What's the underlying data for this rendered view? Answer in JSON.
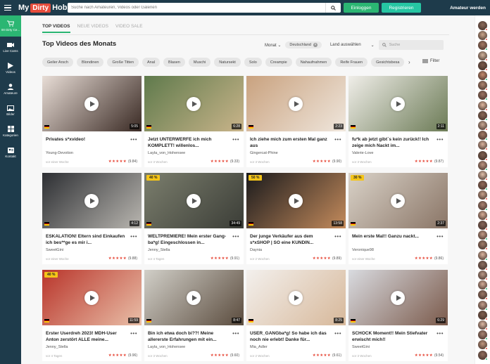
{
  "header": {
    "logo_my": "My",
    "logo_dirty": "Dirty",
    "logo_hobby": "Hobby",
    "search_placeholder": "Suche nach Amateuren, Videos oder Galerien",
    "login_label": "Einloggen",
    "register_label": "Registrieren",
    "become_amateur": "Amateur werden"
  },
  "sidebar": {
    "items": [
      {
        "label": "00 Dirty Ce...",
        "icon": "cart-icon",
        "active": true
      },
      {
        "label": "Live Cams",
        "icon": "camera-icon",
        "active": false
      },
      {
        "label": "Videos",
        "icon": "play-icon",
        "active": false
      },
      {
        "label": "Amateure",
        "icon": "user-icon",
        "active": false
      },
      {
        "label": "Bilder",
        "icon": "images-icon",
        "active": false
      },
      {
        "label": "Kategorien",
        "icon": "grid-icon",
        "active": false
      },
      {
        "label": "Kontakt",
        "icon": "contact-icon",
        "active": false
      }
    ]
  },
  "tabs": [
    {
      "label": "TOP VIDEOS",
      "active": true
    },
    {
      "label": "NEUE VIDEOS",
      "active": false
    },
    {
      "label": "VIDEO SALE",
      "active": false
    }
  ],
  "section_title": "Top Videos des Monats",
  "filters": {
    "period": "Monat",
    "country_chip": "Deutschland",
    "country_select": "Land auswählen",
    "search_placeholder": "Suche",
    "filter_label": "Filter"
  },
  "tags": [
    "Geiler Arsch",
    "Blondinen",
    "Große Titten",
    "Anal",
    "Blasen",
    "Muschi",
    "Natursekt",
    "Solo",
    "Creampie",
    "Nahaufnahmen",
    "Reife Frauen",
    "Gesichtsbesa"
  ],
  "videos": [
    {
      "title": "Privates s*xvideo!",
      "user": "Young-Devotion",
      "date": "vor einer Woche",
      "rating": "(9.84)",
      "duration": "5:05",
      "badge": "",
      "thumb_colors": [
        "#e8ddd6",
        "#3a2a24"
      ]
    },
    {
      "title": "Jetzt UNTERWERFE ich mich KOMPLETT! willenlos...",
      "user": "Layla_von_Hohensee",
      "date": "vor 3 Wochen",
      "rating": "(9.33)",
      "duration": "6:28",
      "badge": "",
      "thumb_colors": [
        "#5f7a4c",
        "#c9b48a"
      ]
    },
    {
      "title": "Ich ziehe mich zum ersten Mal ganz aus",
      "user": "Gingercat-Phine",
      "date": "vor 3 Wochen",
      "rating": "(9.90)",
      "duration": "2:23",
      "badge": "",
      "thumb_colors": [
        "#c9a27f",
        "#efe6dc"
      ]
    },
    {
      "title": "fu*k ab jetzt gibt´s kein zurück!! Ich zeige mich Nackt im...",
      "user": "Valerie-Love",
      "date": "vor 3 Wochen",
      "rating": "(9.87)",
      "duration": "2:11",
      "badge": "",
      "thumb_colors": [
        "#f0eee9",
        "#6c7b56"
      ]
    },
    {
      "title": "ESKALATION! Eltern sind Einkaufen ich bes**ge es mir i...",
      "user": "SweetGini",
      "date": "vor einer Woche",
      "rating": "(9.88)",
      "duration": "4:12",
      "badge": "",
      "thumb_colors": [
        "#2d2f33",
        "#b9b6b0"
      ]
    },
    {
      "title": "WELTPREMIERE! Mein erster Gang-ba*g! Eingeschlossen in...",
      "user": "Jenny_Stella",
      "date": "vor 4 Tagen",
      "rating": "(9.91)",
      "duration": "34:49",
      "badge": "40 %",
      "thumb_colors": [
        "#7b7e6d",
        "#3b3d37"
      ]
    },
    {
      "title": "Der junge Verkäufer aus dem s*xSHOP | SO eine KUNDIN...",
      "user": "Daynia",
      "date": "vor 2 Wochen",
      "rating": "(9.89)",
      "duration": "13:58",
      "badge": "50 %",
      "thumb_colors": [
        "#1a1a1c",
        "#c48b5c"
      ]
    },
    {
      "title": "Mein erste Mal!! Ganzu nackt...",
      "user": "Veronique98",
      "date": "vor einer Woche",
      "rating": "(9.86)",
      "duration": "2:37",
      "badge": "30 %",
      "thumb_colors": [
        "#d9d2c8",
        "#8a7566"
      ]
    },
    {
      "title": "Erster Userdreh 2023! MDH-User Anton zerstört ALLE meine...",
      "user": "Jenny_Stella",
      "date": "vor 4 Tagen",
      "rating": "(9.96)",
      "duration": "11:59",
      "badge": "40 %",
      "thumb_colors": [
        "#b9352b",
        "#e9bfa8"
      ]
    },
    {
      "title": "Bin ich etwa doch bi??! Meine allererste Erfahrungen mit ein...",
      "user": "Layla_von_Hohensee",
      "date": "vor 3 Wochen",
      "rating": "(9.60)",
      "duration": "8:47",
      "badge": "",
      "thumb_colors": [
        "#d1cfc8",
        "#5b4c3e"
      ]
    },
    {
      "title": "USER_GANGba*g! So habe ich das noch nie erlebt! Danke für...",
      "user": "Mia_Adler",
      "date": "vor 2 Wochen",
      "rating": "(9.61)",
      "duration": "8:25",
      "badge": "",
      "thumb_colors": [
        "#f3f0ed",
        "#d7b89a"
      ]
    },
    {
      "title": "SCHOCK Moment!! Mein Stiefvater erwischt mich!!",
      "user": "SweetGini",
      "date": "vor 3 Wochen",
      "rating": "(9.54)",
      "duration": "6:29",
      "badge": "",
      "thumb_colors": [
        "#d9dbe0",
        "#7b5a4b"
      ]
    }
  ],
  "right_avatars": [
    {
      "color": "#8b6b5b",
      "status": "#e74c3c"
    },
    {
      "color": "#c9a58a",
      "status": "#e74c3c"
    },
    {
      "color": "#a47a64",
      "status": "#2bb673"
    },
    {
      "color": "#d1b39c",
      "status": "#e74c3c"
    },
    {
      "color": "#7b5a4b",
      "status": "#e74c3c"
    },
    {
      "color": "#c48b6e",
      "status": "#2bb673"
    },
    {
      "color": "#b08570",
      "status": "#e74c3c"
    },
    {
      "color": "#9c7563",
      "status": "#2bb673"
    },
    {
      "color": "#e0b7a0",
      "status": "#e74c3c"
    },
    {
      "color": "#8a6a58",
      "status": "#2bb673"
    },
    {
      "color": "#c9a893",
      "status": "#e74c3c"
    },
    {
      "color": "#a37b66",
      "status": "#2bb673"
    },
    {
      "color": "#d9b29d",
      "status": "#e74c3c"
    },
    {
      "color": "#7d5f50",
      "status": "#e74c3c"
    },
    {
      "color": "#bc9480",
      "status": "#2bb673"
    },
    {
      "color": "#e1c0ab",
      "status": "#e74c3c"
    },
    {
      "color": "#936b5a",
      "status": "#2bb673"
    },
    {
      "color": "#c6a08a",
      "status": "#e74c3c"
    },
    {
      "color": "#aa8472",
      "status": "#2bb673"
    },
    {
      "color": "#d7ad97",
      "status": "#e74c3c"
    },
    {
      "color": "#86665a",
      "status": "#e74c3c"
    },
    {
      "color": "#c29b86",
      "status": "#2bb673"
    },
    {
      "color": "#a17c69",
      "status": "#e74c3c"
    },
    {
      "color": "#dbb6a0",
      "status": "#2bb673"
    },
    {
      "color": "#8c6e60",
      "status": "#e74c3c"
    },
    {
      "color": "#b89886",
      "status": "#e74c3c"
    },
    {
      "color": "#d3ad98",
      "status": "#2bb673"
    },
    {
      "color": "#9a7766",
      "status": "#e74c3c"
    },
    {
      "color": "#c49f8c",
      "status": "#2bb673"
    },
    {
      "color": "#7f5e4f",
      "status": "#e74c3c"
    },
    {
      "color": "#ddb9a4",
      "status": "#e74c3c"
    },
    {
      "color": "#a88573",
      "status": "#2bb673"
    },
    {
      "color": "#c0977f",
      "status": "#e74c3c"
    },
    {
      "color": "#916f5f",
      "status": "#2bb673"
    }
  ],
  "colors": {
    "topbar": "#1e3b4b",
    "accent": "#2bb673",
    "star": "#e74c3c",
    "badge": "#f5c518"
  }
}
